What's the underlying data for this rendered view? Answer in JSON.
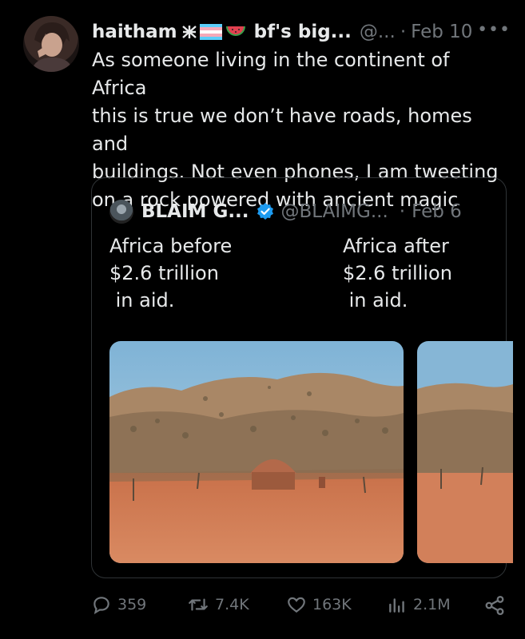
{
  "tweet": {
    "display_name": "haitham",
    "display_name_rest": "bf's big...",
    "handle": "@...",
    "separator": "·",
    "date": "Feb 10",
    "more_icon": "more-icon",
    "text": "As someone living in the continent of Africa\nthis is true we don’t have roads, homes and\nbuildings. Not even phones, I am tweeting\non a rock powered with ancient magic"
  },
  "quote": {
    "display_name": "BLAIM G...",
    "handle": "@BLAIMG...",
    "separator": "·",
    "date": "Feb 6",
    "caption_left": "Africa before\n$2.6 trillion\n in aid.",
    "caption_right": "Africa after\n$2.6 trillion\n in aid."
  },
  "actions": {
    "replies": "359",
    "retweets": "7.4K",
    "likes": "163K",
    "views": "2.1M"
  },
  "icons": [
    "reply-icon",
    "retweet-icon",
    "heart-icon",
    "views-icon",
    "share-icon",
    "verified-icon"
  ],
  "colors": {
    "background": "#000000",
    "text": "#e7e9ea",
    "muted": "#71767b",
    "border": "#2f3336",
    "verified": "#1d9bf0"
  }
}
